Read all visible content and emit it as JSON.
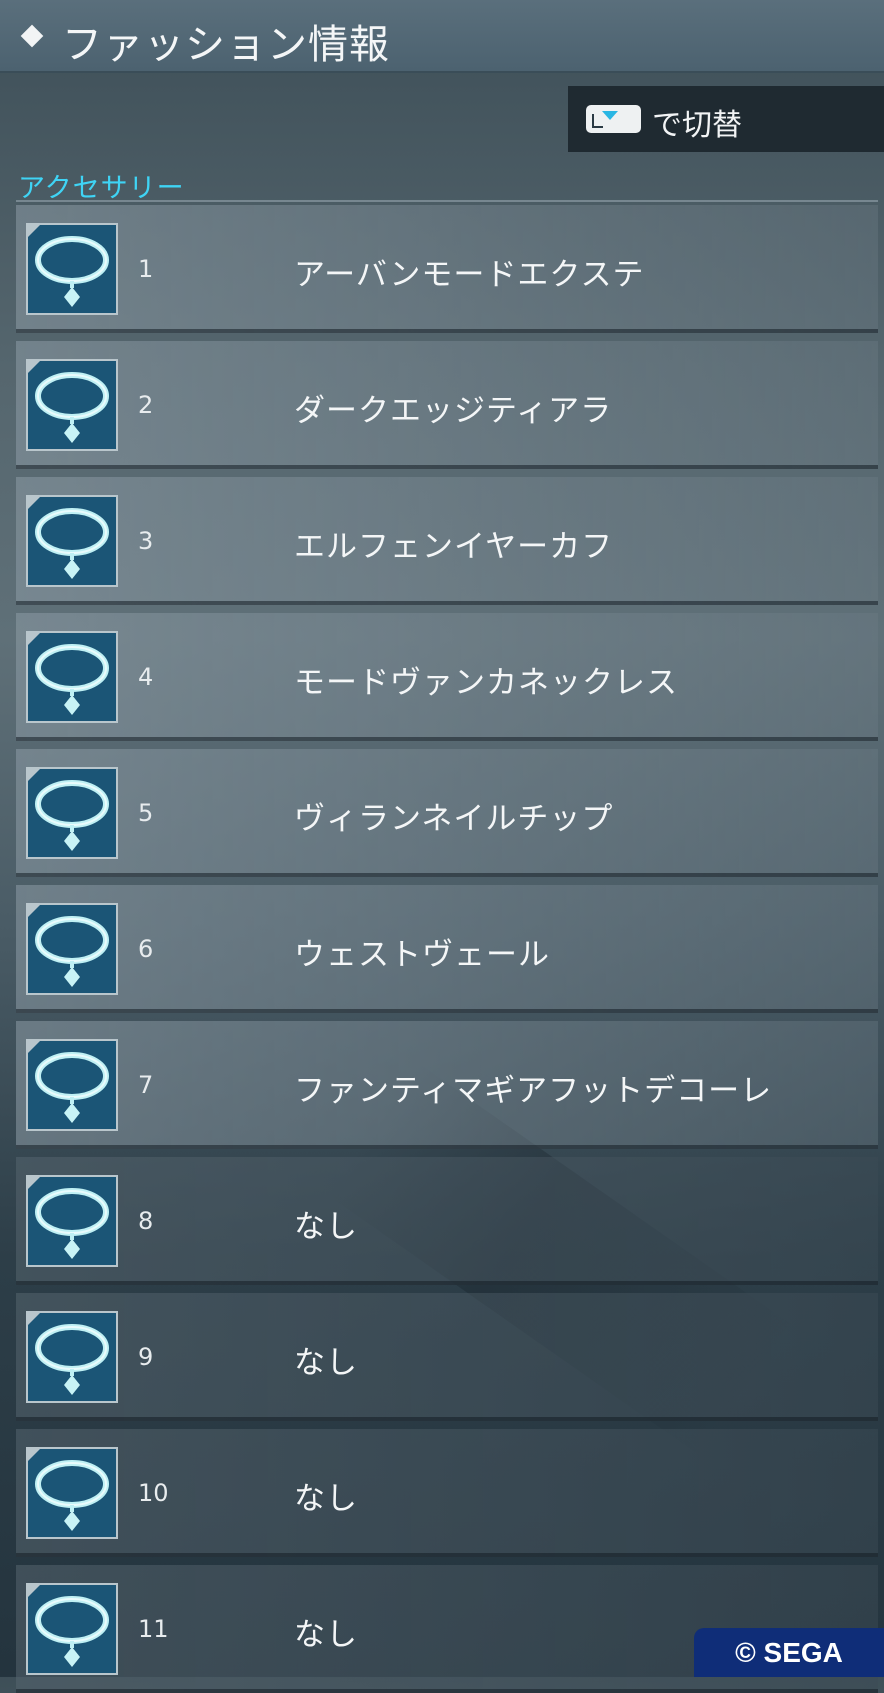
{
  "header": {
    "title": "ファッション情報"
  },
  "switch": {
    "label": "で切替",
    "button_icon": "l-trigger-icon"
  },
  "section": {
    "label": "アクセサリー"
  },
  "items": [
    {
      "num": "1",
      "name": "アーバンモードエクステ"
    },
    {
      "num": "2",
      "name": "ダークエッジティアラ"
    },
    {
      "num": "3",
      "name": "エルフェンイヤーカフ"
    },
    {
      "num": "4",
      "name": "モードヴァンカネックレス"
    },
    {
      "num": "5",
      "name": "ヴィランネイルチップ"
    },
    {
      "num": "6",
      "name": "ウェストヴェール"
    },
    {
      "num": "7",
      "name": "ファンティマギアフットデコーレ"
    },
    {
      "num": "8",
      "name": "なし"
    },
    {
      "num": "9",
      "name": "なし"
    },
    {
      "num": "10",
      "name": "なし"
    },
    {
      "num": "11",
      "name": "なし"
    }
  ],
  "copyright": "© SEGA",
  "colors": {
    "accent": "#3fd4f5",
    "icon_bg": "#1b5576",
    "icon_line": "#bff0f4"
  }
}
